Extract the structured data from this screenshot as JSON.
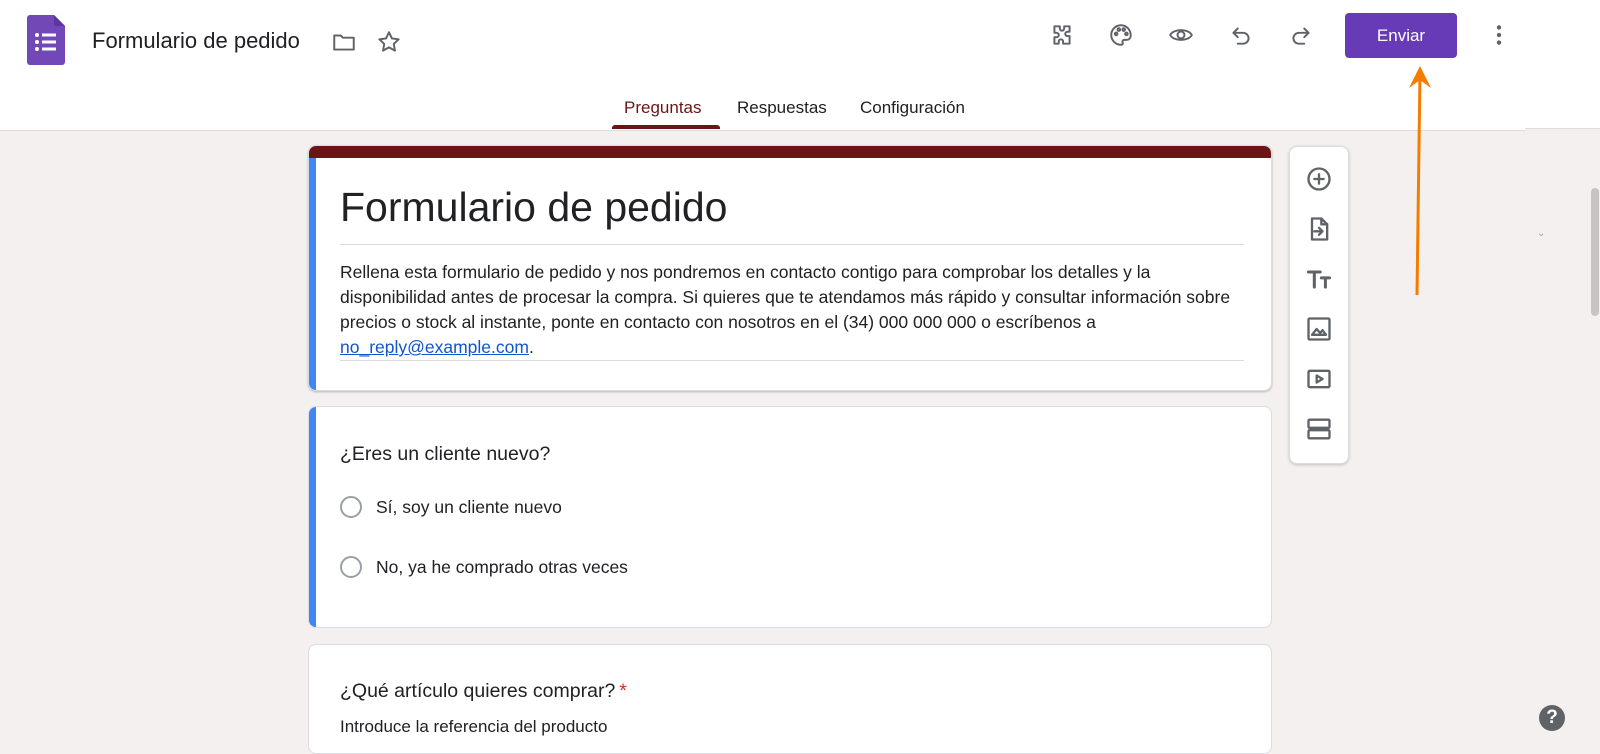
{
  "header": {
    "doc_title": "Formulario de pedido",
    "send_label": "Enviar",
    "icons": [
      "forms-logo-icon",
      "folder-icon",
      "star-icon",
      "addons-icon",
      "palette-icon",
      "preview-eye-icon",
      "undo-icon",
      "redo-icon",
      "more-vert-icon"
    ]
  },
  "tabs": [
    {
      "label": "Preguntas",
      "active": true
    },
    {
      "label": "Respuestas",
      "active": false
    },
    {
      "label": "Configuración",
      "active": false
    }
  ],
  "form": {
    "title": "Formulario de pedido",
    "description": "Rellena esta formulario de pedido y nos pondremos en contacto contigo para comprobar los detalles y la disponibilidad antes de procesar la compra. Si quieres que te atendamos más rápido y consultar información sobre precios o stock al instante, ponte en contacto con nosotros en el (34) 000 000 000 o escríbenos a ",
    "email": "no_reply@example.com",
    "description_end": "."
  },
  "questions": [
    {
      "title": "¿Eres un cliente nuevo?",
      "options": [
        "Sí, soy un cliente nuevo",
        "No, ya he comprado otras veces"
      ]
    },
    {
      "title": "¿Qué artículo quieres comprar?",
      "required_mark": "*",
      "subtitle": "Introduce la referencia del producto"
    }
  ],
  "toolbar": {
    "tools": [
      "add-question-icon",
      "import-questions-icon",
      "add-title-icon",
      "add-image-icon",
      "add-video-icon",
      "add-section-icon"
    ]
  },
  "help": {
    "label": "?"
  },
  "colors": {
    "accent": "#673ab7",
    "theme": "#6b1516",
    "focus": "#4285f4",
    "background": "#f4f0ef",
    "arrow": "#f57c00"
  }
}
